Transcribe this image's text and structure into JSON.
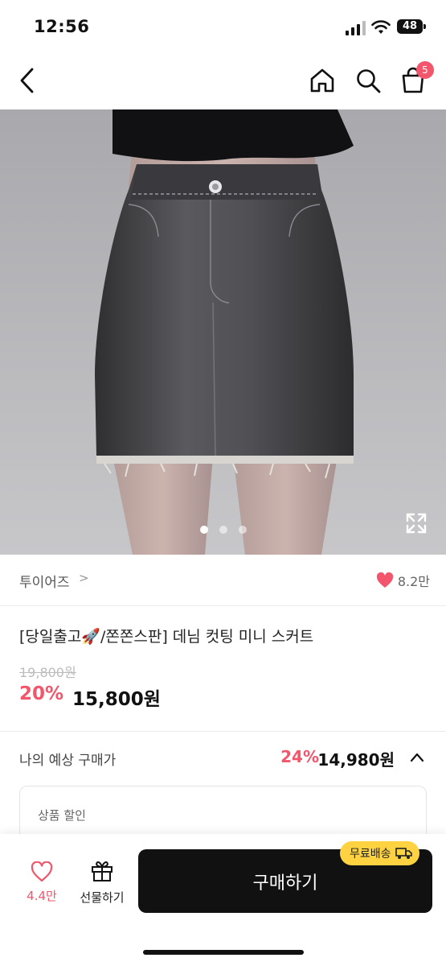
{
  "status_bar": {
    "time": "12:56",
    "battery": "48"
  },
  "nav": {
    "cart_count": "5"
  },
  "product_image": {
    "carousel_index": 1,
    "carousel_total": 3
  },
  "brand": {
    "name": "투이어즈",
    "chevron": ">",
    "like_count": "8.2만"
  },
  "product": {
    "title_part1": "[당일출고",
    "title_emoji": "🚀",
    "title_part2": "/쫀쫀스판] 데님 컷팅 미니 스커트",
    "original_price": "19,800원",
    "discount_rate": "20%",
    "sale_price": "15,800원"
  },
  "expected_price": {
    "label": "나의 예상 구매가",
    "rate": "24%",
    "price": "14,980원"
  },
  "discount_box": {
    "title": "상품 할인"
  },
  "bottom_bar": {
    "wish_count": "4.4만",
    "gift_label": "선물하기",
    "buy_label": "구매하기",
    "free_ship_label": "무료배송"
  },
  "colors": {
    "accent": "#f2556c",
    "buy_button": "#111111",
    "badge_yellow": "#ffd241"
  }
}
